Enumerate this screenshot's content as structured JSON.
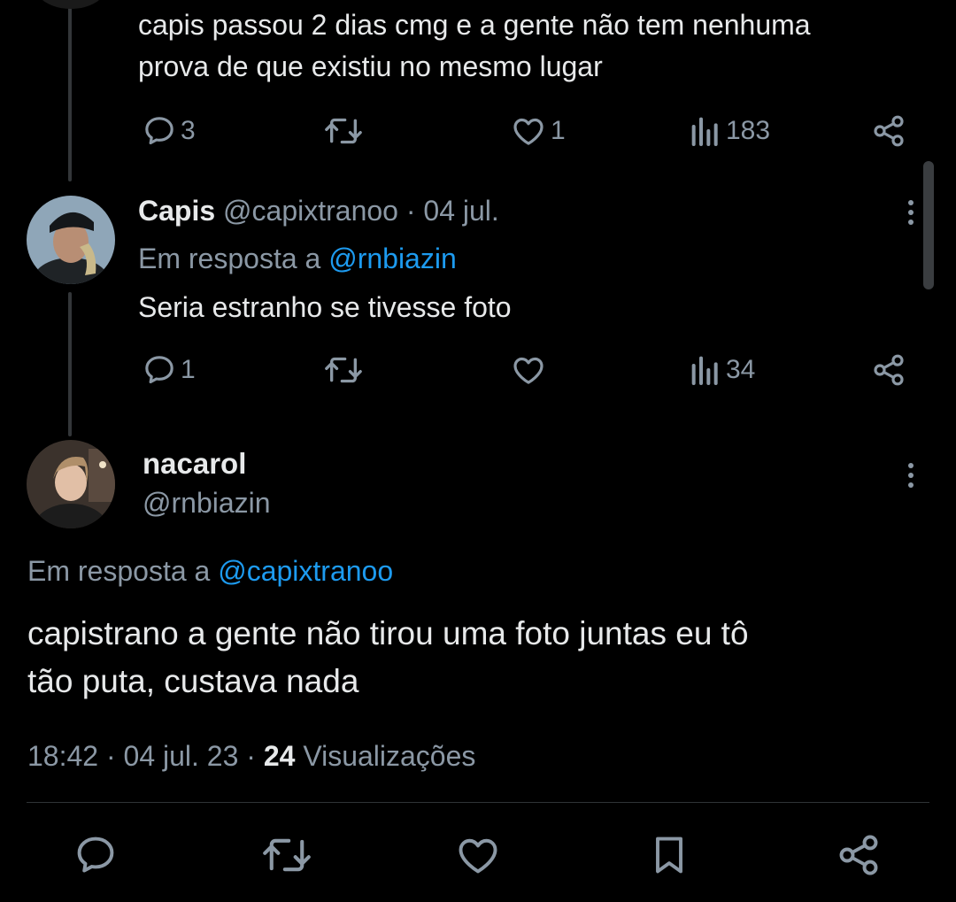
{
  "prev_tweet": {
    "text_line1": "capis passou 2 dias cmg e a gente não tem nenhuma",
    "text_line2": "prova de que existiu no mesmo lugar",
    "replies": "3",
    "likes": "1",
    "views": "183"
  },
  "reply_tweet": {
    "name": "Capis",
    "handle": "@capixtranoo",
    "separator": "·",
    "date": "04 jul.",
    "in_reply_prefix": "Em resposta a",
    "in_reply_handle": "@rnbiazin",
    "text": "Seria estranho se tivesse foto",
    "replies": "1",
    "likes": "",
    "views": "34"
  },
  "main_tweet": {
    "name": "nacarol",
    "handle": "@rnbiazin",
    "in_reply_prefix": "Em resposta a",
    "in_reply_handle": "@capixtranoo",
    "text_line1": "capistrano a gente não tirou uma foto juntas eu tô",
    "text_line2": "tão puta, custava nada",
    "time": "18:42",
    "sep1": "·",
    "date": "04 jul. 23",
    "sep2": "·",
    "views_count": "24",
    "views_label": "Visualizações"
  },
  "icons": {
    "reply": "reply-icon",
    "retweet": "retweet-icon",
    "like": "heart-icon",
    "views": "views-icon",
    "share": "share-icon",
    "bookmark": "bookmark-icon",
    "more": "more-icon"
  },
  "colors": {
    "background": "#000000",
    "text": "#e7e9ea",
    "secondary": "#8b98a5",
    "link": "#1d9bf0"
  }
}
